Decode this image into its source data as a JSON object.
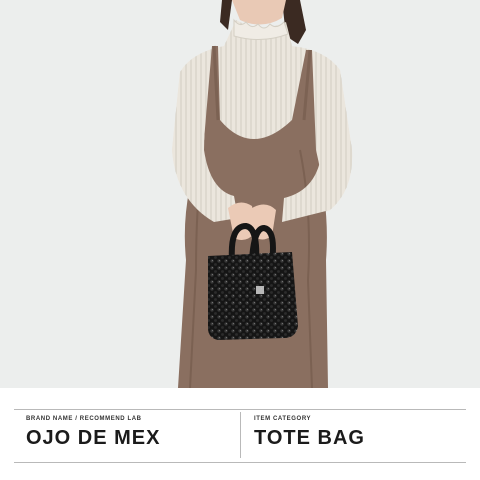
{
  "product_card": {
    "brand": {
      "caption": "BRAND NAME / RECOMMEND LAB",
      "value": "OJO DE MEX"
    },
    "category": {
      "caption": "ITEM CATEGORY",
      "value": "TOTE BAG"
    }
  },
  "colors": {
    "photo_background": "#eceeed",
    "dress": "#8a6f60",
    "blouse": "#e8e3da",
    "bag": "#1a1a1a",
    "rule": "#b9b9b9",
    "text": "#1b1b1b"
  }
}
